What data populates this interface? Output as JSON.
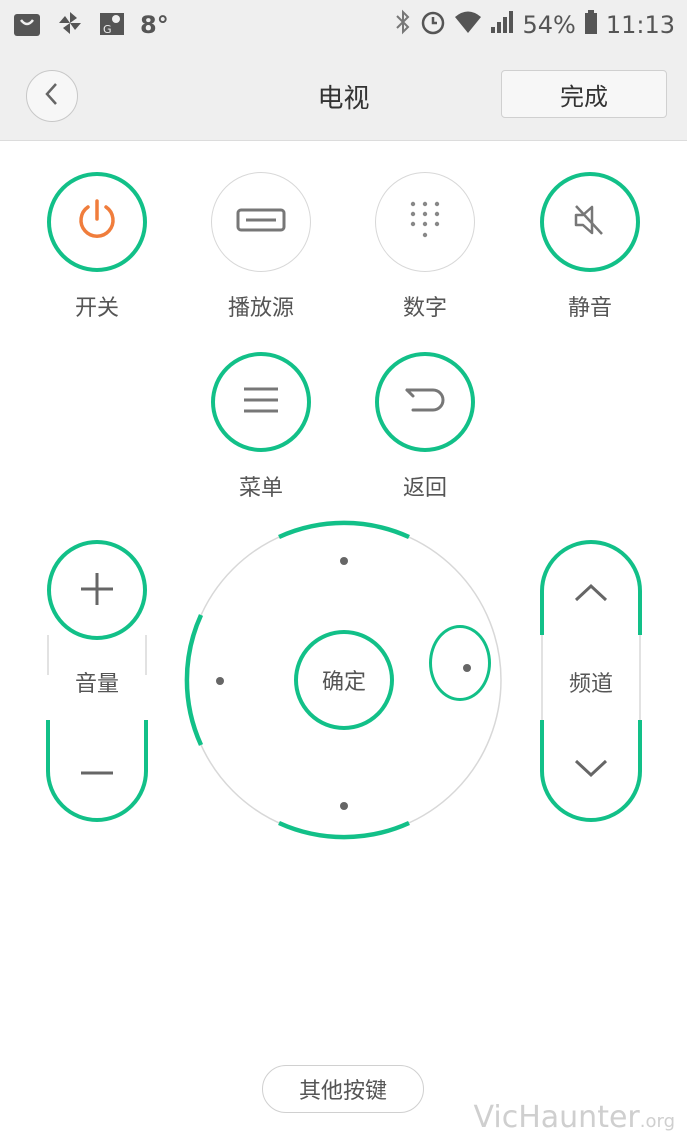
{
  "status_bar": {
    "temperature": "8°",
    "battery": "54%",
    "time": "11:13"
  },
  "header": {
    "title": "电视",
    "done_label": "完成"
  },
  "buttons": {
    "power": "开关",
    "source": "播放源",
    "number": "数字",
    "mute": "静音",
    "menu": "菜单",
    "back": "返回"
  },
  "volume": {
    "label": "音量"
  },
  "channel": {
    "label": "频道"
  },
  "dpad": {
    "ok_label": "确定"
  },
  "footer": {
    "other_keys_label": "其他按键",
    "watermark_main": "VicHaunter",
    "watermark_suffix": ".org"
  },
  "colors": {
    "accent": "#12c088",
    "power": "#f07d3c"
  }
}
